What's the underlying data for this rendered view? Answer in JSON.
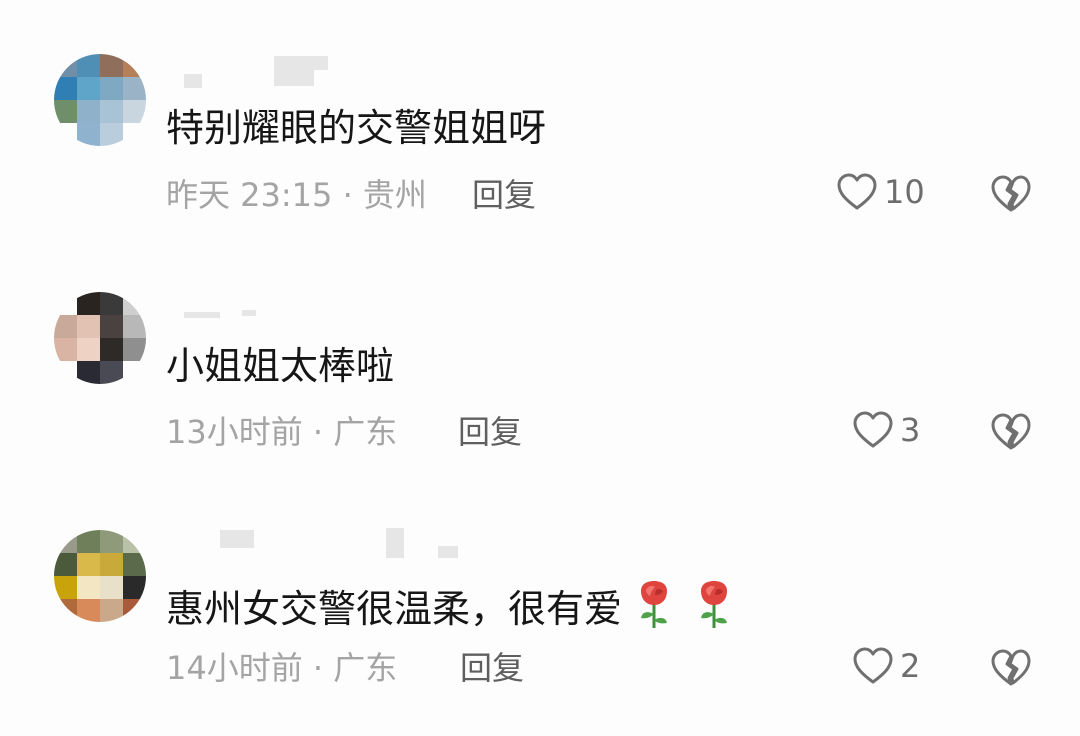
{
  "comments": [
    {
      "text": "特别耀眼的交警姐姐呀",
      "meta": "昨天 23:15 · 贵州",
      "reply_label": "回复",
      "like_count": "10",
      "emoji": []
    },
    {
      "text": "小姐姐太棒啦",
      "meta": "13小时前 · 广东",
      "reply_label": "回复",
      "like_count": "3",
      "emoji": []
    },
    {
      "text": "惠州女交警很温柔，很有爱",
      "meta": "14小时前 · 广东",
      "reply_label": "回复",
      "like_count": "2",
      "emoji": [
        "rose-emoji",
        "rose-emoji"
      ]
    }
  ],
  "colors": {
    "text": "#161616",
    "meta": "#a4a4a4",
    "reply": "#5f5f5f",
    "icon": "#707070",
    "rose": "#e0443f",
    "stem": "#3e8f3a"
  },
  "icons": {
    "like": "heart-outline-icon",
    "dislike": "broken-heart-icon"
  }
}
